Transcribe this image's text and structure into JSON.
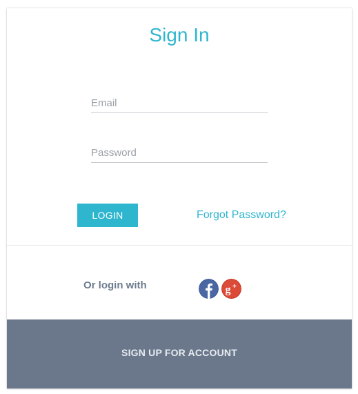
{
  "form": {
    "title": "Sign In",
    "email_placeholder": "Email",
    "email_value": "",
    "password_placeholder": "Password",
    "password_value": "",
    "login_label": "LOGIN",
    "forgot_label": "Forgot Password?"
  },
  "social": {
    "label": "Or login with",
    "providers": [
      {
        "name": "facebook",
        "icon": "facebook-icon",
        "color": "#3b5998"
      },
      {
        "name": "google-plus",
        "icon": "google-plus-icon",
        "color": "#dc4a38"
      }
    ]
  },
  "footer": {
    "signup_label": "SIGN UP FOR ACCOUNT"
  },
  "colors": {
    "accent": "#2fb6cf",
    "footer_bg": "#6b788c",
    "muted_text": "#6d7c8e"
  }
}
